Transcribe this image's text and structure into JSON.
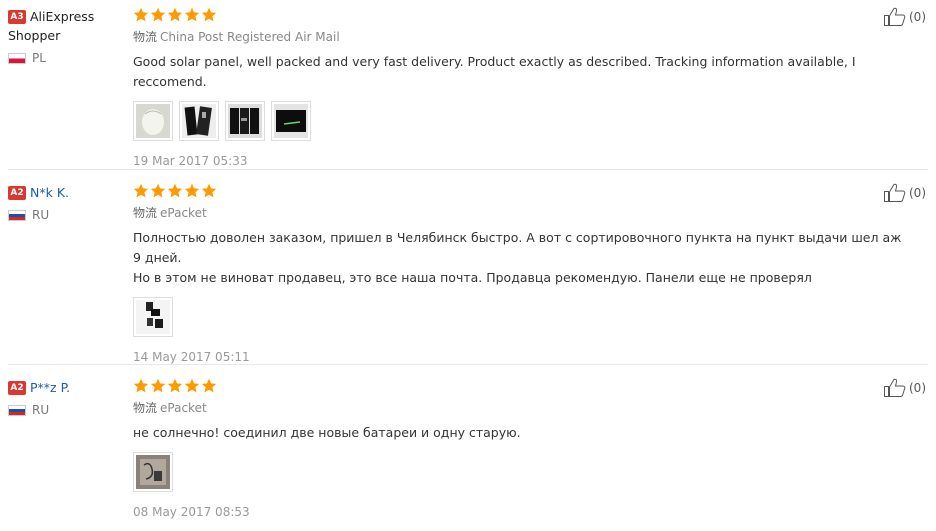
{
  "reviews": [
    {
      "level": "A3",
      "name": "AliExpress Shopper",
      "country": "PL",
      "flag": "pl",
      "stars": 5,
      "shipping_label": "物流",
      "shipping": "China Post Registered Air Mail",
      "text": "Good solar panel, well packed and very fast delivery. Product exactly as described. Tracking information available, I reccomend.",
      "photos": 4,
      "date": "19 Mar 2017 05:33",
      "likes": "(0)"
    },
    {
      "level": "A2",
      "name": "N*k K.",
      "country": "RU",
      "flag": "ru",
      "stars": 5,
      "shipping_label": "物流",
      "shipping": "ePacket",
      "text_line1": "Полностью доволен заказом, пришел в Челябинск быстро. А вот с сортировочного пункта на пункт выдачи шел аж 9 дней.",
      "text_line2": "Но в этом не виноват продавец, это все наша почта. Продавца рекомендую. Панели еще не проверял",
      "photos": 1,
      "date": "14 May 2017 05:11",
      "likes": "(0)"
    },
    {
      "level": "A2",
      "name": "P**z P.",
      "country": "RU",
      "flag": "ru",
      "stars": 5,
      "shipping_label": "物流",
      "shipping": "ePacket",
      "text": "не солнечно! соединил две новые батареи и одну старую.",
      "photos": 1,
      "date": "08 May 2017 08:53",
      "likes": "(0)"
    }
  ],
  "colors": {
    "star": "#ff9a00",
    "level_badge": "#d9382e",
    "link": "#1a5ca8"
  },
  "icons": {
    "star": "star-icon",
    "like": "thumbs-up-icon"
  }
}
